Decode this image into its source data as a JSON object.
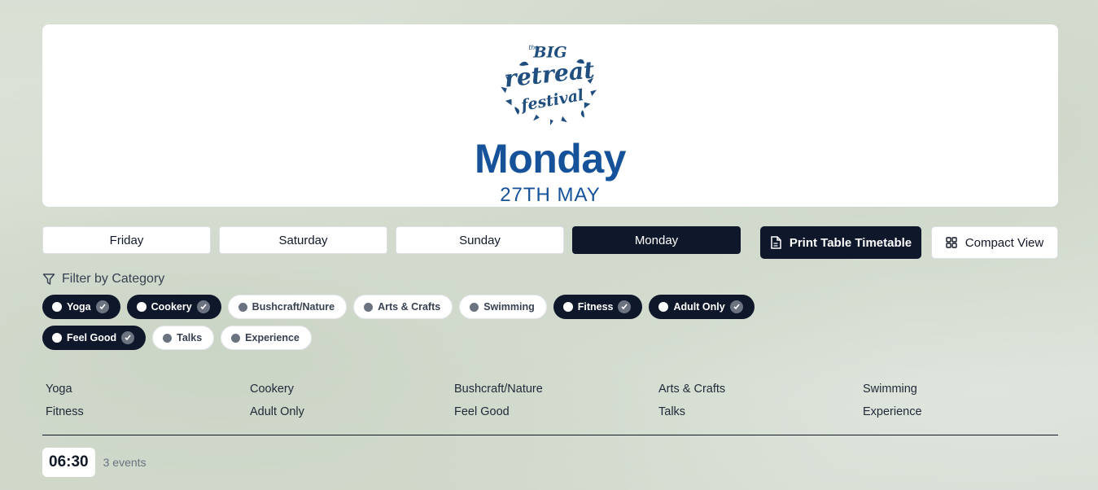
{
  "header": {
    "logo_text": "the BIG retreat festival",
    "day_title": "Monday",
    "date": "27TH MAY"
  },
  "days": [
    {
      "label": "Friday",
      "active": false
    },
    {
      "label": "Saturday",
      "active": false
    },
    {
      "label": "Sunday",
      "active": false
    },
    {
      "label": "Monday",
      "active": true
    }
  ],
  "actions": {
    "print_label": "Print Table Timetable",
    "compact_label": "Compact View"
  },
  "filter": {
    "label": "Filter by Category",
    "chips": [
      {
        "label": "Yoga",
        "selected": true
      },
      {
        "label": "Cookery",
        "selected": true
      },
      {
        "label": "Bushcraft/Nature",
        "selected": false
      },
      {
        "label": "Arts & Crafts",
        "selected": false
      },
      {
        "label": "Swimming",
        "selected": false
      },
      {
        "label": "Fitness",
        "selected": true
      },
      {
        "label": "Adult Only",
        "selected": true
      },
      {
        "label": "Feel Good",
        "selected": true
      },
      {
        "label": "Talks",
        "selected": false
      },
      {
        "label": "Experience",
        "selected": false
      }
    ]
  },
  "legend": [
    "Yoga",
    "Cookery",
    "Bushcraft/Nature",
    "Arts & Crafts",
    "Swimming",
    "Fitness",
    "Adult Only",
    "Feel Good",
    "Talks",
    "Experience"
  ],
  "timeslot": {
    "time": "06:30",
    "count": "3 events"
  },
  "colors": {
    "brand": "#16529a",
    "dark": "#0f172a"
  }
}
